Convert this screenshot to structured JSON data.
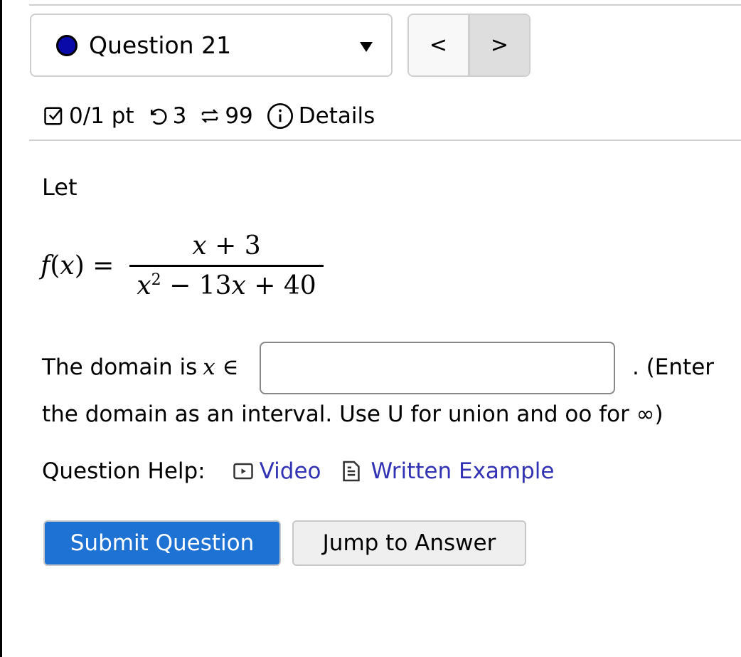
{
  "header": {
    "question_selector": {
      "label": "Question 21",
      "status_color": "#0a0aa8"
    },
    "nav": {
      "prev_label": "<",
      "next_label": ">"
    }
  },
  "meta": {
    "score": "0/1 pt",
    "retries": "3",
    "attempts": "99",
    "details_label": "Details"
  },
  "question": {
    "intro": "Let",
    "formula": {
      "lhs": "f(x) =",
      "numerator": "x + 3",
      "denominator_prefix": "x",
      "denominator_exp": "2",
      "denominator_rest": " − 13x + 40"
    },
    "domain_prefix": "The domain is",
    "domain_symbol": "x ∈",
    "answer_value": "",
    "domain_suffix": ". (Enter",
    "instructions": "the domain as an interval. Use U for union and oo for ∞)"
  },
  "help": {
    "label": "Question Help:",
    "video_label": "Video",
    "written_label": "Written Example"
  },
  "actions": {
    "submit_label": "Submit Question",
    "jump_label": "Jump to Answer"
  }
}
